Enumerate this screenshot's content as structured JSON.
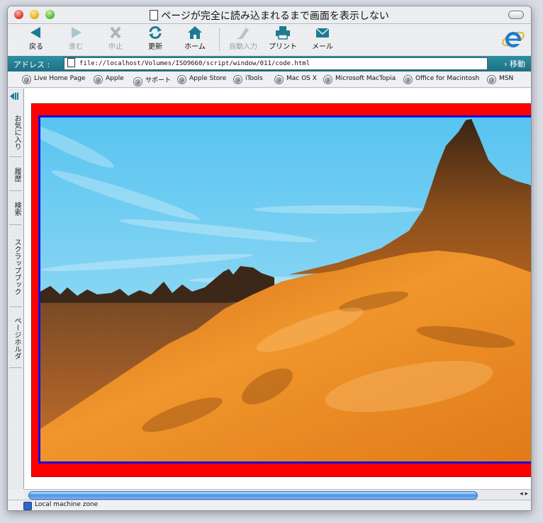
{
  "window": {
    "title": "ページが完全に読み込まれるまで画面を表示しない"
  },
  "toolbar": {
    "buttons": [
      {
        "label": "戻る",
        "icon": "back-arrow-icon",
        "enabled": true
      },
      {
        "label": "進む",
        "icon": "forward-arrow-icon",
        "enabled": false
      },
      {
        "label": "中止",
        "icon": "stop-x-icon",
        "enabled": false
      },
      {
        "label": "更新",
        "icon": "refresh-icon",
        "enabled": true
      },
      {
        "label": "ホーム",
        "icon": "home-icon",
        "enabled": true
      },
      {
        "label": "自動入力",
        "icon": "autofill-icon",
        "enabled": false
      },
      {
        "label": "プリント",
        "icon": "print-icon",
        "enabled": true
      },
      {
        "label": "メール",
        "icon": "mail-icon",
        "enabled": true
      }
    ]
  },
  "address": {
    "label": "アドレス :",
    "url": "file://localhost/Volumes/ISO9660/script/window/011/code.html",
    "go_label": "移動"
  },
  "links": [
    "Live Home Page",
    "Apple",
    "サポート",
    "Apple Store",
    "iTools",
    "Mac OS X",
    "Microsoft MacTopia",
    "Office for Macintosh",
    "MSN"
  ],
  "sidebar": {
    "tabs": [
      "お気に入り",
      "履歴",
      "検索",
      "スクラップブック",
      "ページホルダ"
    ]
  },
  "status": {
    "text": "Local machine zone"
  },
  "colors": {
    "accent_teal": "#1e6f82",
    "frame_red": "#ff0000",
    "frame_blue": "#1010e0"
  }
}
